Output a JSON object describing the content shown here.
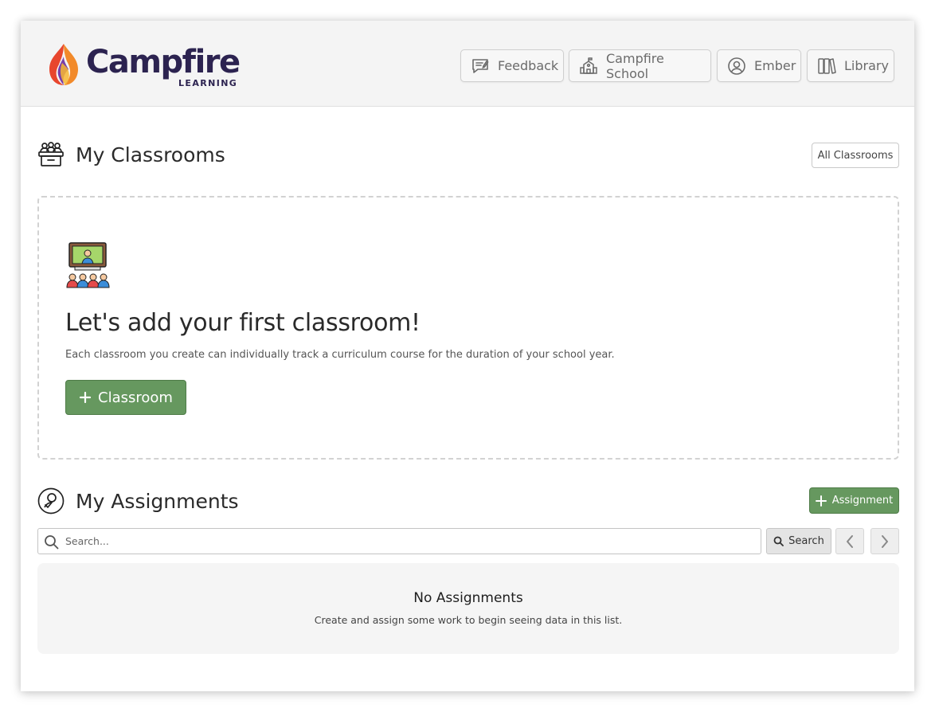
{
  "header": {
    "logo": {
      "wordmark": "Campfire",
      "sub": "LEARNING",
      "icon": "campfire-flame-logo"
    },
    "nav": [
      {
        "label": "Feedback",
        "icon": "feedback-icon"
      },
      {
        "label": "Campfire School",
        "icon": "school-icon"
      },
      {
        "label": "Ember",
        "icon": "user-circle-icon"
      },
      {
        "label": "Library",
        "icon": "library-icon"
      }
    ]
  },
  "classrooms": {
    "title": "My Classrooms",
    "icon": "classroom-desk-icon",
    "all_button": "All Classrooms",
    "empty": {
      "illustration": "teacher-classroom-illustration",
      "heading": "Let's add your first classroom!",
      "description": "Each classroom you create can individually track a curriculum course for the duration of your school year.",
      "button_label": "Classroom"
    }
  },
  "assignments": {
    "title": "My Assignments",
    "icon": "assignment-user-icon",
    "add_button": "Assignment",
    "search": {
      "placeholder": "Search...",
      "value": "",
      "button_label": "Search"
    },
    "empty": {
      "title": "No Assignments",
      "subtitle": "Create and assign some work to begin seeing data in this list."
    }
  },
  "colors": {
    "primary_green": "#66985f",
    "brand_navy": "#2c2350",
    "header_bg": "#f4f4f4"
  }
}
